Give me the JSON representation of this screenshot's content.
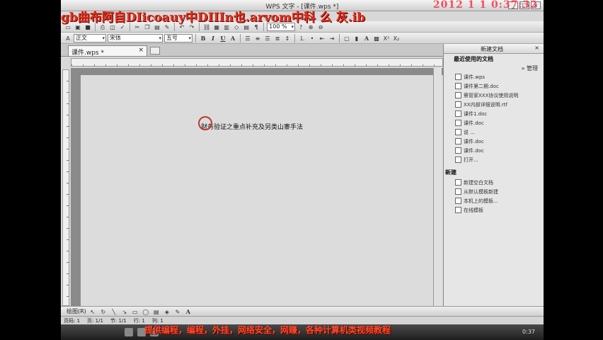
{
  "window": {
    "title": "WPS 文字 - [课件.wps *]",
    "controls": [
      "_",
      "□",
      "×"
    ]
  },
  "overlay": {
    "watermark": "gb曲布阿自DIicoauy中DIIIn也.arvom中科 么 灰.ib",
    "clock": "2012 1 1 0:37:32",
    "footer_ad": "提供编程，编程，外挂，网络安全，网赚，各种计算机类视频教程"
  },
  "toolbar": {
    "style_value": "正文",
    "font_value": "宋体",
    "size_value": "五号",
    "zoom_value": "100 %",
    "bold": "B",
    "italic": "I",
    "underline": "U",
    "font_color": "A",
    "superscript": "X²",
    "subscript": "X₂"
  },
  "tabs": {
    "doc_tab": "课件.wps *",
    "close": "×"
  },
  "document": {
    "text": "财务验证之重点补充及另类山寨手法"
  },
  "taskpane": {
    "title": "新建文档",
    "close": "×",
    "recent_heading": "最近使用的文档",
    "manage_link": "» 管理",
    "recent_items": [
      "课件.wps",
      "课件第二期.doc",
      "蔡管家XXX协议使用说明",
      "XX内部详细说明.rtf",
      "课件1.doc",
      "课件.doc",
      "说 ...",
      "课件.doc",
      "课件.doc",
      "打开..."
    ],
    "new_heading": "新建",
    "new_items": [
      "新建空白文档",
      "从默认模板新建",
      "本机上的模板...",
      "在线模板"
    ]
  },
  "drawbar": {
    "label": "绘图(R)",
    "icons": [
      "cursor",
      "rotate",
      "line",
      "arrow",
      "rect",
      "oval",
      "textbox",
      "fill",
      "linecolor",
      "fontcolor"
    ]
  },
  "status": {
    "page": "页码: 1",
    "pages": "页: 1/1",
    "section": "节: 1/1",
    "row": "行: 1",
    "col": "列: 1"
  },
  "taskbar": {
    "time": "0:37"
  }
}
